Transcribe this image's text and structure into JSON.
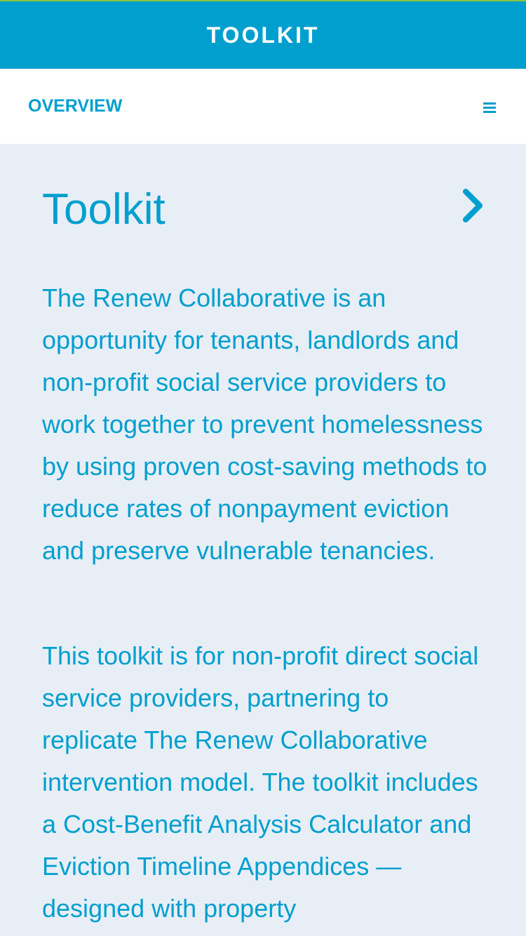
{
  "header": {
    "title": "TOOLKIT"
  },
  "nav": {
    "section_label": "OVERVIEW",
    "menu_icon": "hamburger-menu-icon"
  },
  "main": {
    "title": "Toolkit",
    "next_icon": "chevron-right-icon",
    "paragraphs": [
      "The Renew Collaborative is an opportunity for tenants, landlords and non-profit social service providers to work together to prevent homelessness by using proven cost-saving methods to reduce rates of nonpayment eviction and preserve vulnerable tenancies.",
      "This toolkit is for non-profit direct social service providers, partnering to replicate The Renew Collaborative intervention model. The toolkit includes a Cost-Benefit Analysis Calculator and Eviction Timeline Appendices — designed with property"
    ]
  },
  "colors": {
    "brand_blue": "#009fce",
    "background": "#e8eef6",
    "accent_green": "#8cc63f",
    "white": "#ffffff"
  }
}
